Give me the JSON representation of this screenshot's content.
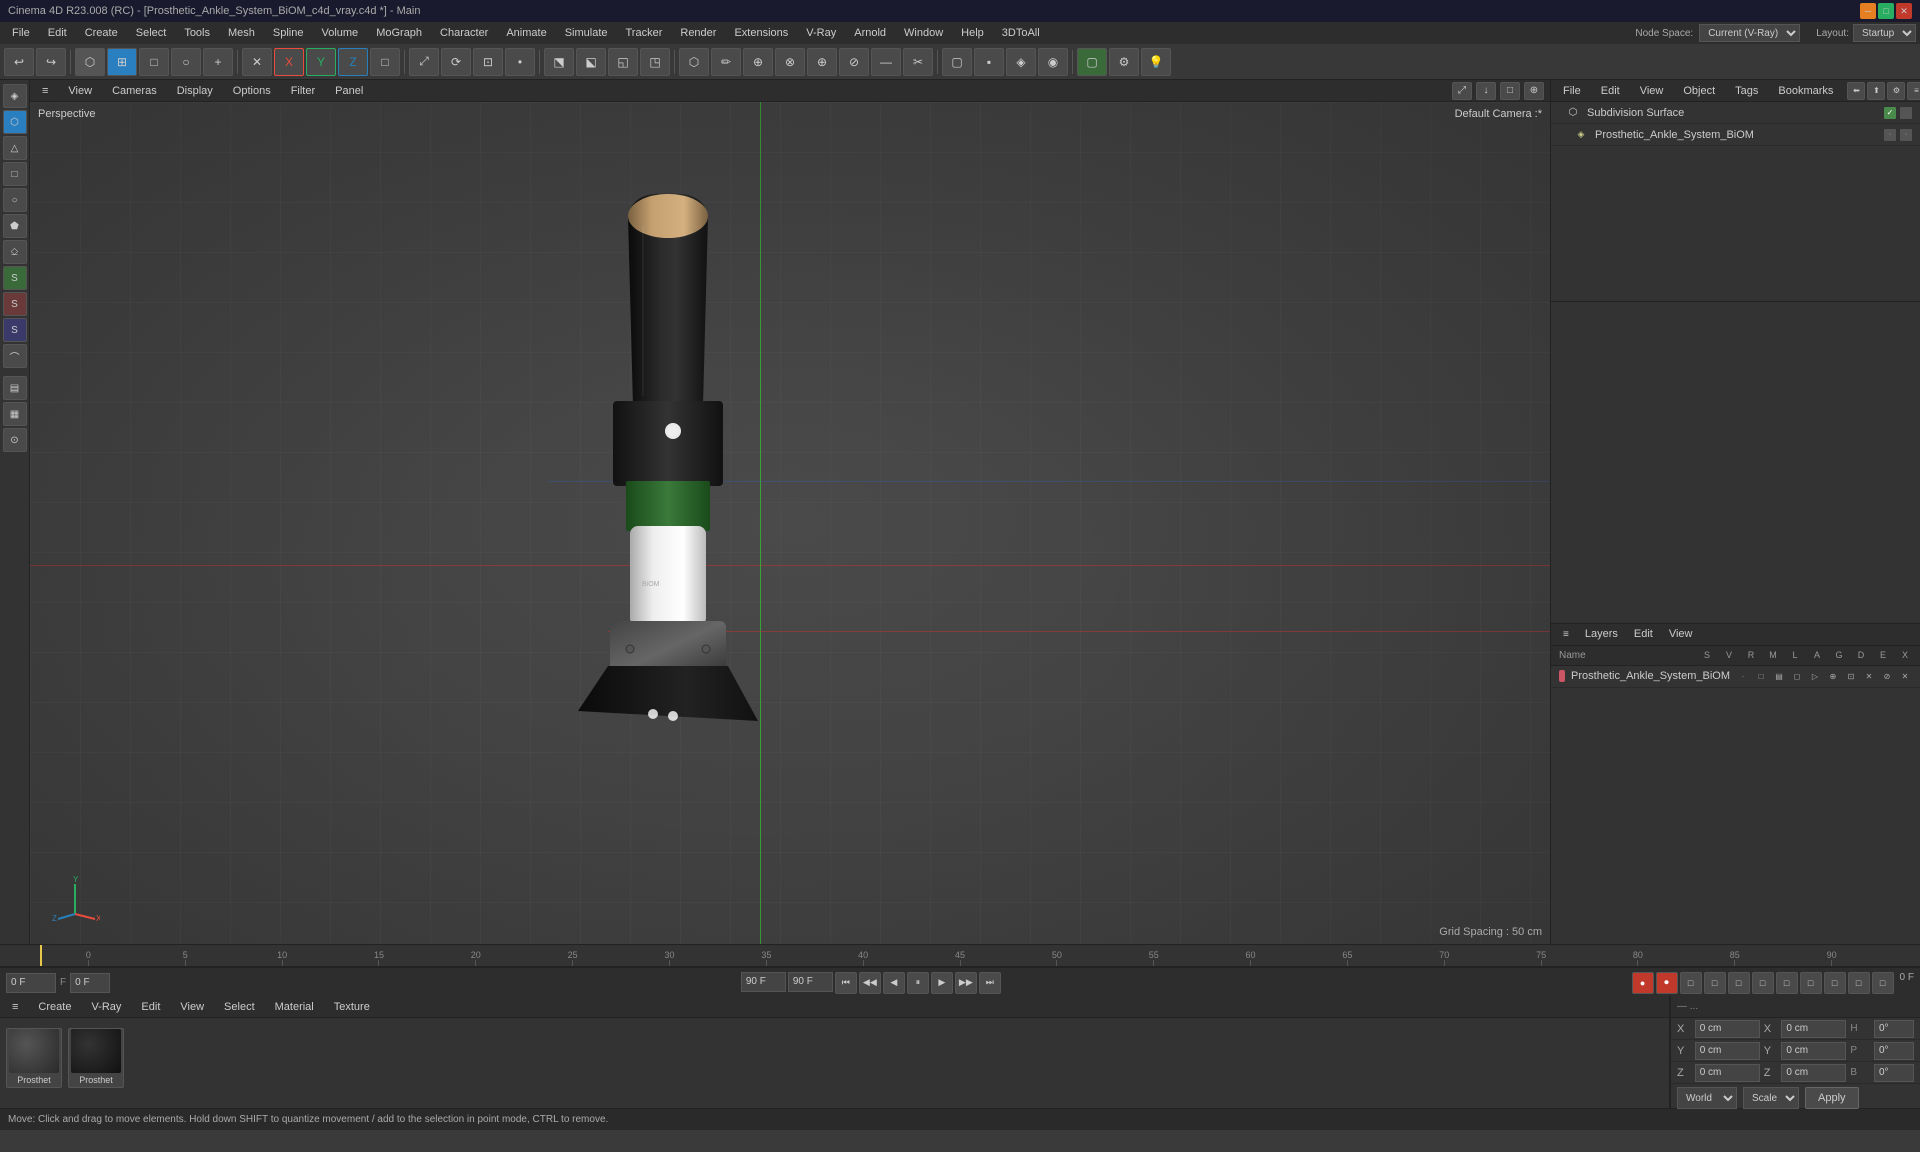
{
  "titleBar": {
    "title": "Cinema 4D R23.008 (RC) - [Prosthetic_Ankle_System_BiOM_c4d_vray.c4d *] - Main",
    "minBtn": "─",
    "maxBtn": "□",
    "closeBtn": "✕"
  },
  "menuBar": {
    "items": [
      "File",
      "Edit",
      "Create",
      "Select",
      "Tools",
      "Mesh",
      "Spline",
      "Volume",
      "MoGraph",
      "Character",
      "Animate",
      "Simulate",
      "Tracker",
      "Render",
      "Extensions",
      "V-Ray",
      "Arnold",
      "Window",
      "Help",
      "3DToAll"
    ],
    "nodeSpaceLabel": "Node Space:",
    "nodeSpaceValue": "Current (V-Ray)",
    "layoutLabel": "Layout:",
    "layoutValue": "Startup"
  },
  "viewport": {
    "perspLabel": "Perspective",
    "cameraLabel": "Default Camera :*",
    "gridLabel": "Grid Spacing : 50 cm",
    "menus": [
      "≡",
      "View",
      "Cameras",
      "Display",
      "Options",
      "Filter",
      "Panel"
    ],
    "iconBtns": [
      "⤢",
      "⬇",
      "□",
      "⊕"
    ]
  },
  "rightPanel": {
    "menus": [
      "File",
      "Edit",
      "View",
      "Object",
      "Tags",
      "Bookmarks"
    ],
    "objects": [
      {
        "name": "Subdivision Surface",
        "icon": "⬡",
        "selected": false
      },
      {
        "name": "Prosthetic_Ankle_System_BiOM",
        "icon": "◈",
        "selected": false
      }
    ],
    "layersHeader": [
      "Layers",
      "Edit",
      "View"
    ],
    "layerColumns": {
      "name": "Name",
      "flags": [
        "S",
        "V",
        "R",
        "M",
        "L",
        "A",
        "G",
        "D",
        "E",
        "X"
      ]
    },
    "layers": [
      {
        "name": "Prosthetic_Ankle_System_BiOM",
        "color": "#cc5566"
      }
    ]
  },
  "timeline": {
    "marks": [
      "0",
      "5",
      "10",
      "15",
      "20",
      "25",
      "30",
      "35",
      "40",
      "45",
      "50",
      "55",
      "60",
      "65",
      "70",
      "75",
      "80",
      "85",
      "90"
    ],
    "currentFrame": "0 F",
    "startFrame": "0 F",
    "endFrame": "90 F",
    "minFrame": "0 F",
    "maxFrame": "90 F"
  },
  "contentArea": {
    "menus": [
      "≡",
      "Create",
      "V-Ray",
      "Edit",
      "View",
      "Select",
      "Material",
      "Texture"
    ],
    "materials": [
      {
        "label": "Prosthet",
        "color": "#2a2a2a"
      },
      {
        "label": "Prosthet",
        "color": "#1a1a1a"
      }
    ]
  },
  "coords": {
    "rows": [
      {
        "label": "X",
        "val1": "0 cm",
        "label2": "X",
        "val2": "0 cm",
        "suffix": "H",
        "val3": "0°"
      },
      {
        "label": "Y",
        "val1": "0 cm",
        "label2": "Y",
        "val2": "0 cm",
        "suffix": "P",
        "val3": "0°"
      },
      {
        "label": "Z",
        "val1": "0 cm",
        "label2": "Z",
        "val2": "0 cm",
        "suffix": "B",
        "val3": "0°"
      }
    ],
    "worldLabel": "World",
    "scaleLabel": "Scale",
    "applyLabel": "Apply"
  },
  "statusBar": {
    "text": "Move: Click and drag to move elements. Hold down SHIFT to quantize movement / add to the selection in point mode, CTRL to remove."
  },
  "leftSidebar": {
    "icons": [
      "◈",
      "⬡",
      "△",
      "□",
      "○",
      "⬟",
      "⎐",
      "S",
      "S",
      "S",
      "⌒",
      "▤",
      "▦",
      "⊙"
    ]
  },
  "toolbar": {
    "groups": [
      [
        "↩",
        "↪"
      ],
      [
        "⬡",
        "□",
        "⊞",
        "○",
        "⊕"
      ],
      [
        "✕",
        "X",
        "Y",
        "Z",
        "⬜"
      ],
      [
        "⌕",
        "⟳",
        "⊡",
        "●"
      ],
      [
        "◱",
        "◳",
        "⬔",
        "⬕"
      ],
      [
        "⬡",
        "✏",
        "⋯",
        "⊕",
        "⊗",
        "⊕",
        "⊘",
        "—",
        "✂"
      ],
      [
        "▢",
        "▪",
        "◈",
        "◉"
      ],
      [
        "⚙",
        "💡"
      ]
    ]
  },
  "transportBtns": {
    "buttons": [
      "⏮",
      "◀◀",
      "◀",
      "⏸",
      "▶",
      "▶▶",
      "⏭"
    ],
    "rightButtons": [
      "🔴",
      "🔴",
      "⏺",
      "⬜",
      "⬜",
      "⬜",
      "⬜",
      "⬜",
      "⬜",
      "⬜",
      "⬜"
    ]
  }
}
